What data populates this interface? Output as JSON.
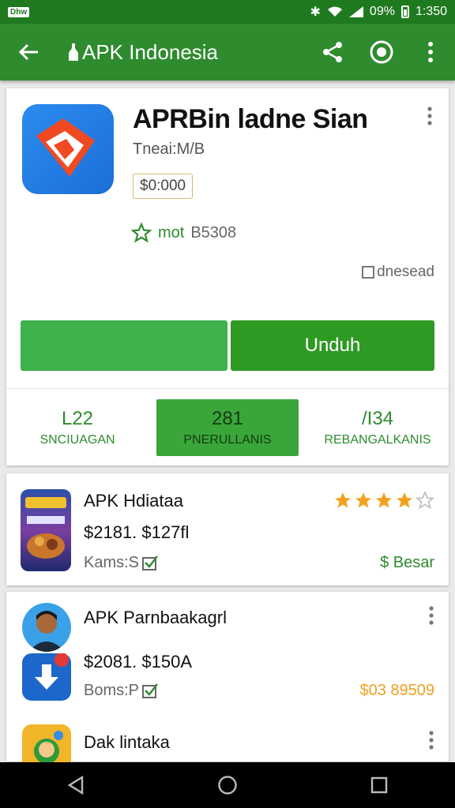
{
  "status_bar": {
    "chip": "Dhw",
    "battery": "09%",
    "time": "1:350"
  },
  "app_bar": {
    "title": "APK Indonesia"
  },
  "app": {
    "title": "APRBin ladne Sian",
    "developer": "Tneai:M/B",
    "price": "$0:000",
    "rating_label": "mot",
    "rating_count": "B5308",
    "installed_label": "dnesead",
    "install_button": "Unduh",
    "accent_color": "#2e8b2e"
  },
  "stats": [
    {
      "value": "L22",
      "label": "SNCIUAGAN",
      "active": false
    },
    {
      "value": "281",
      "label": "PNERULLANIS",
      "active": true
    },
    {
      "value": "/I34",
      "label": "REBANGALKANIS",
      "active": false
    }
  ],
  "list": [
    {
      "title": "APK Hdiataa",
      "price": "$2181. $127fl",
      "meta": "Kams:S",
      "tag": "$ Besar",
      "rating_stars": 4
    },
    {
      "title": "APK Parnbaakagrl",
      "price": "$2081. $150A",
      "meta": "Boms:P",
      "tag": "$03 89509"
    },
    {
      "title": "Dak lintaka"
    }
  ],
  "icons": {
    "back": "back-arrow-icon",
    "share": "share-icon",
    "target": "target-icon",
    "more": "more-vert-icon",
    "nav_back": "nav-back-icon",
    "nav_home": "nav-home-icon",
    "nav_recents": "nav-recents-icon"
  }
}
